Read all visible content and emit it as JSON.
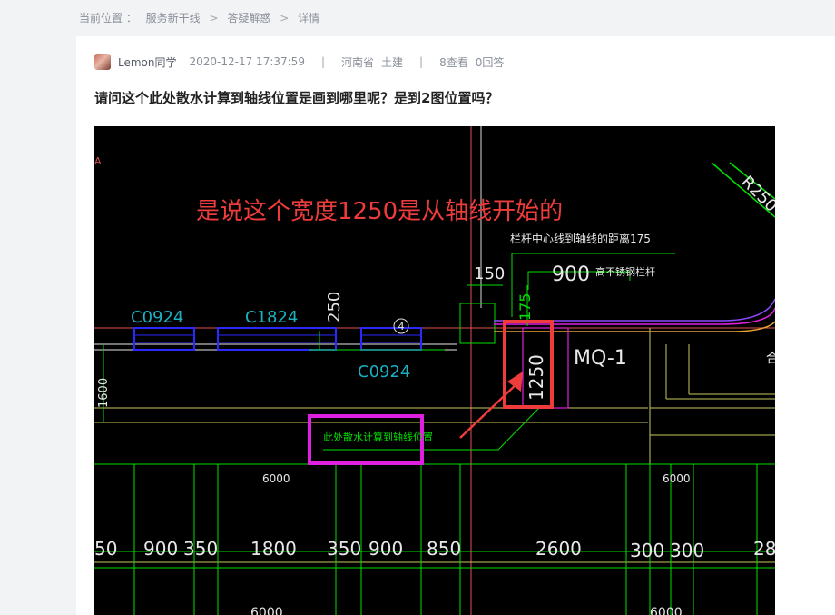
{
  "breadcrumb": {
    "label": "当前位置 ：",
    "items": [
      "服务新干线",
      "答疑解惑",
      "详情"
    ],
    "separator": ">"
  },
  "question": {
    "author": "Lemon同学",
    "datetime": "2020-12-17 17:37:59",
    "meta_separator": "|",
    "province": "河南省",
    "major": "土建",
    "views": "8查看",
    "answers": "0回答",
    "title": "请问这个此处散水计算到轴线位置是画到哪里呢？是到2图位置吗？"
  },
  "drawing": {
    "annotation_main": "是说这个宽度1250是从轴线开始的",
    "annotation_box": "此处散水计算到轴线位置",
    "rail_label": "栏杆中心线到轴线的距离175",
    "rail_material": "高不锈钢栏杆",
    "window_labels": [
      "C0924",
      "C1824",
      "C0924"
    ],
    "curtain_wall": "MQ-1",
    "axis_number": "4",
    "radius_label": "R250",
    "dims_top": [
      "150",
      "900",
      "250",
      "175",
      "1250"
    ],
    "dims_left": "1600",
    "dims_span": [
      "6000",
      "6000",
      "6000",
      "6000"
    ],
    "dims_row": [
      "50",
      "900",
      "350",
      "1800",
      "350",
      "900",
      "850",
      "2600",
      "300",
      "300",
      "28"
    ],
    "edge_mark_left": "A",
    "edge_mark_right": "合",
    "colors": {
      "background": "#000000",
      "green": "#00e000",
      "cyan": "#1ab0c0",
      "white": "#e8e8e8",
      "magenta": "#e020e0",
      "red": "#ee3b3b",
      "yellow": "#c8c85a",
      "blue": "#2a2aff"
    }
  }
}
